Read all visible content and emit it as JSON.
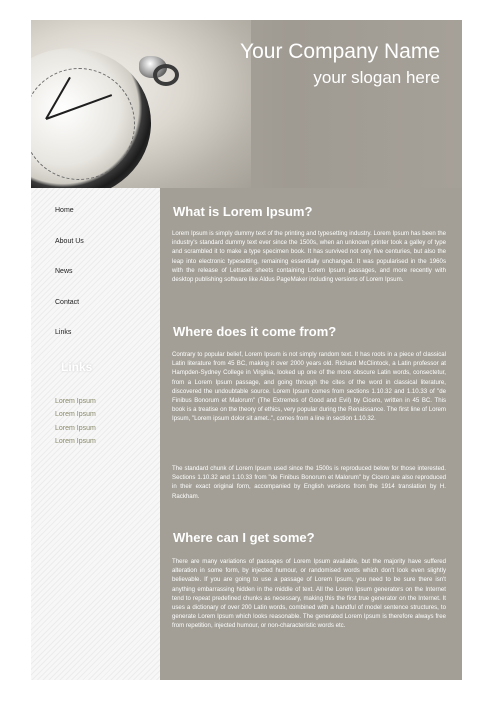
{
  "header": {
    "company_name": "Your Company Name",
    "slogan": "your slogan here"
  },
  "nav": {
    "items": [
      {
        "label": "Home"
      },
      {
        "label": "About Us"
      },
      {
        "label": "News"
      },
      {
        "label": "Contact"
      },
      {
        "label": "Links"
      }
    ]
  },
  "sidebar_links": {
    "heading": "Links",
    "items": [
      {
        "label": "Lorem Ipsum"
      },
      {
        "label": "Lorem Ipsum"
      },
      {
        "label": "Lorem Ipsum"
      },
      {
        "label": "Lorem Ipsum"
      }
    ]
  },
  "sections": [
    {
      "heading": "What is Lorem Ipsum?",
      "paragraphs": [
        "Lorem Ipsum is simply dummy text of the printing and typesetting industry. Lorem Ipsum has been the industry's standard dummy text ever since the 1500s, when an unknown printer took a galley of type and scrambled it to make a type specimen book. It has survived not only five centuries, but also the leap into electronic typesetting, remaining essentially unchanged. It was popularised in the 1960s with the release of Letraset sheets containing Lorem Ipsum passages, and more recently with desktop publishing software like Aldus PageMaker including versions of Lorem Ipsum."
      ]
    },
    {
      "heading": "Where does it come from?",
      "paragraphs": [
        "Contrary to popular belief, Lorem Ipsum is not simply random text. It has roots in a piece of classical Latin literature from 45 BC, making it over 2000 years old. Richard McClintock, a Latin professor at Hampden-Sydney College in Virginia, looked up one of the more obscure Latin words, consectetur, from a Lorem Ipsum passage, and going through the cites of the word in classical literature, discovered the undoubtable source. Lorem Ipsum comes from sections 1.10.32 and 1.10.33 of \"de Finibus Bonorum et Malorum\" (The Extremes of Good and Evil) by Cicero, written in 45 BC. This book is a treatise on the theory of ethics, very popular during the Renaissance. The first line of Lorem Ipsum, \"Lorem ipsum dolor sit amet..\", comes from a line in section 1.10.32.",
        "The standard chunk of Lorem Ipsum used since the 1500s is reproduced below for those interested. Sections 1.10.32 and 1.10.33 from \"de Finibus Bonorum et Malorum\" by Cicero are also reproduced in their exact original form, accompanied by English versions from the 1914 translation by H. Rackham."
      ]
    },
    {
      "heading": "Where can I get some?",
      "paragraphs": [
        "There are many variations of passages of Lorem Ipsum available, but the majority have suffered alteration in some form, by injected humour, or randomised words which don't look even slightly believable. If you are going to use a passage of Lorem Ipsum, you need to be sure there isn't anything embarrassing hidden in the middle of text. All the Lorem Ipsum generators on the Internet tend to repeat predefined chunks as necessary, making this the first true generator on the Internet. It uses a dictionary of over 200 Latin words, combined with a handful of model sentence structures, to generate Lorem Ipsum which looks reasonable. The generated Lorem Ipsum is therefore always free from repetition, injected humour, or non-characteristic words etc."
      ]
    }
  ]
}
